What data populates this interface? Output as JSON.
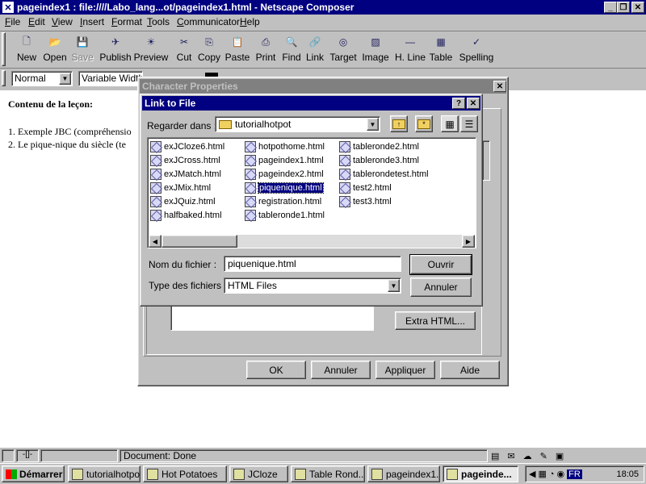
{
  "window": {
    "title": "pageindex1 : file:////Labo_lang...ot/pageindex1.html - Netscape Composer"
  },
  "menu": [
    "File",
    "Edit",
    "View",
    "Insert",
    "Format",
    "Tools",
    "Communicator",
    "Help"
  ],
  "toolbar": [
    "New",
    "Open",
    "Save",
    "Publish",
    "Preview",
    "Cut",
    "Copy",
    "Paste",
    "Print",
    "Find",
    "Link",
    "Target",
    "Image",
    "H. Line",
    "Table",
    "Spelling"
  ],
  "format_bar": {
    "style": "Normal",
    "font": "Variable Width"
  },
  "document": {
    "heading": "Contenu de la leçon:",
    "items": [
      "1. Exemple JBC (compréhensio",
      "2. Le pique-nique du siècle (te"
    ]
  },
  "char_props": {
    "title": "Character Properties",
    "extra_html": "Extra HTML...",
    "ok": "OK",
    "cancel": "Annuler",
    "apply": "Appliquer",
    "help": "Aide"
  },
  "link_dialog": {
    "title": "Link to File",
    "look_in_label": "Regarder dans :",
    "look_in": "tutorialhotpot",
    "files": [
      [
        "exJCloze6.html",
        "exJCross.html",
        "exJMatch.html",
        "exJMix.html",
        "exJQuiz.html",
        "halfbaked.html"
      ],
      [
        "hotpothome.html",
        "pageindex1.html",
        "pageindex2.html",
        "piquenique.html",
        "registration.html",
        "tableronde1.html"
      ],
      [
        "tableronde2.html",
        "tableronde3.html",
        "tablerondetest.html",
        "test2.html",
        "test3.html"
      ]
    ],
    "selected": "piquenique.html",
    "filename_label": "Nom du fichier :",
    "filename": "piquenique.html",
    "type_label": "Type des fichiers :",
    "type": "HTML Files",
    "open": "Ouvrir",
    "cancel": "Annuler"
  },
  "status": {
    "text": "Document: Done"
  },
  "taskbar": {
    "start": "Démarrer",
    "tasks": [
      "tutorialhotpot",
      "Hot Potatoes",
      "JCloze",
      "Table Rond...",
      "pageindex1...",
      "pageinde..."
    ],
    "lang": "FR",
    "clock": "18:05"
  }
}
